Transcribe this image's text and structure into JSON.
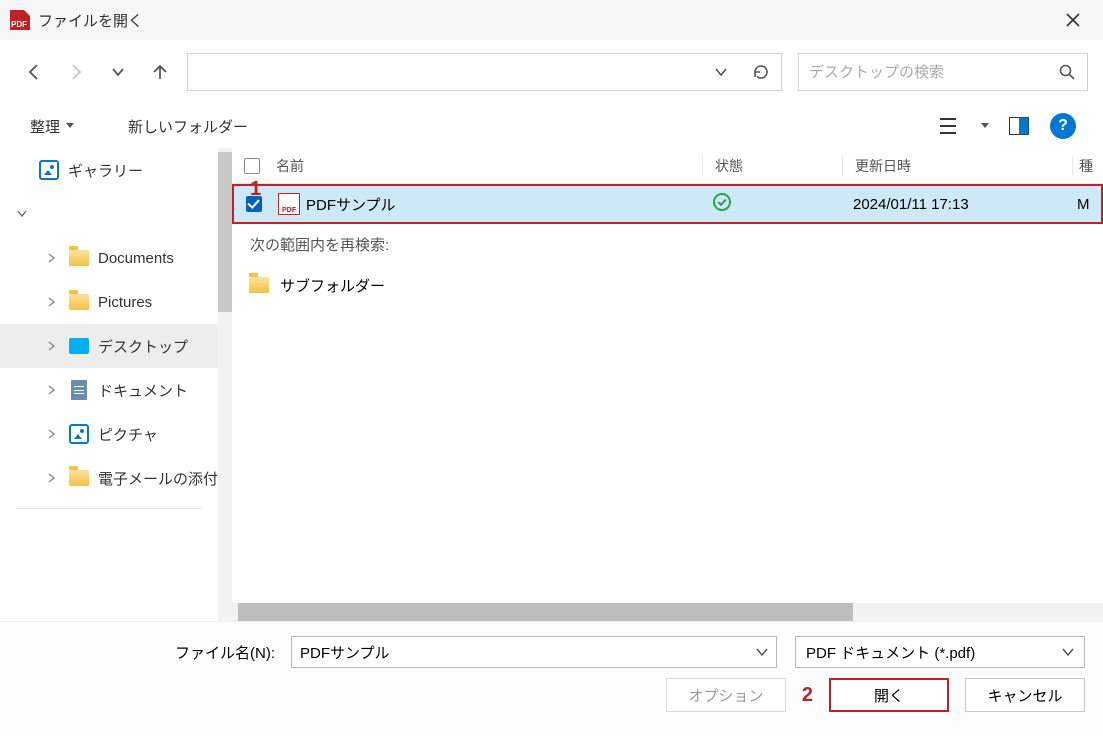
{
  "titlebar": {
    "app_icon_label": "PDF",
    "title": "ファイルを開く"
  },
  "nav": {
    "search_placeholder": "デスクトップの検索"
  },
  "toolbar": {
    "organize": "整理",
    "new_folder": "新しいフォルダー"
  },
  "sidebar": {
    "items": [
      {
        "label": "ギャラリー",
        "icon": "gallery"
      },
      {
        "label": "",
        "icon": "none",
        "expanded": true
      },
      {
        "label": "Documents",
        "icon": "folder"
      },
      {
        "label": "Pictures",
        "icon": "folder"
      },
      {
        "label": "デスクトップ",
        "icon": "desktop",
        "selected": true
      },
      {
        "label": "ドキュメント",
        "icon": "doc"
      },
      {
        "label": "ピクチャ",
        "icon": "gallery"
      },
      {
        "label": "電子メールの添付",
        "icon": "folder"
      }
    ]
  },
  "columns": {
    "name": "名前",
    "status": "状態",
    "modified": "更新日時",
    "type": "種"
  },
  "files": [
    {
      "name": "PDFサンプル",
      "status": "ok",
      "date": "2024/01/11 17:13",
      "type": "M",
      "selected": true
    }
  ],
  "research_label": "次の範囲内を再検索:",
  "subfolder_label": "サブフォルダー",
  "footer": {
    "filename_label": "ファイル名(N):",
    "filename_value": "PDFサンプル",
    "type_filter": "PDF ドキュメント (*.pdf)",
    "options": "オプション",
    "open": "開く",
    "cancel": "キャンセル"
  },
  "annotations": {
    "one": "1",
    "two": "2"
  }
}
